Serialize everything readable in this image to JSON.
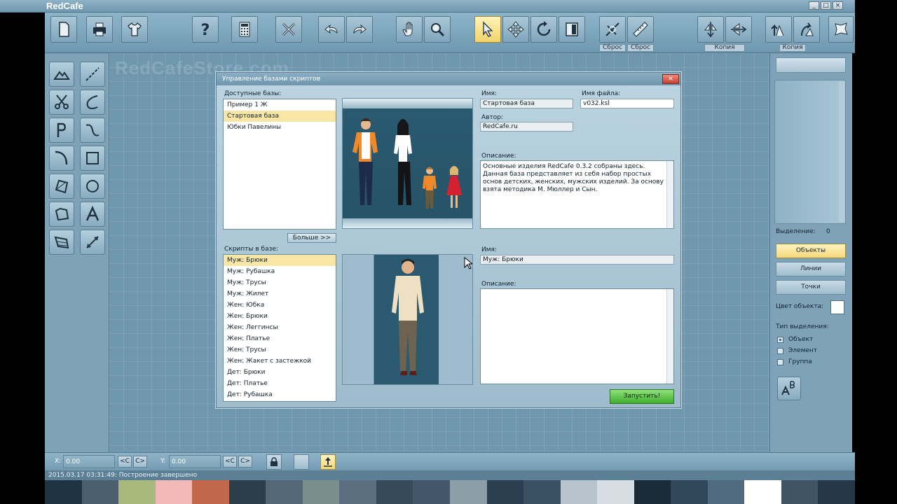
{
  "app": {
    "title": "RedCafe",
    "watermark": "RedCafeStore.com"
  },
  "window_controls": {
    "minimize": "_",
    "maximize": "□",
    "close": "×"
  },
  "toolbar": {
    "captions": {
      "reset_1": "Сброс",
      "reset_2": "Сброс",
      "copy_1": "Копия",
      "copy_2": "Копия"
    },
    "buttons": [
      "file-icon",
      "print-icon",
      "shirt-icon",
      "help-icon",
      "calculator-icon",
      "delete-icon",
      "undo-icon",
      "redo-icon",
      "hand-icon",
      "zoom-icon",
      "pointer-icon",
      "move-icon",
      "rotate-icon",
      "frame-icon",
      "reset-transform-icon",
      "ruler-icon",
      "mirror-vertical-icon",
      "mirror-horizontal-icon",
      "copy-left-icon",
      "copy-right-icon",
      "shape-icon"
    ]
  },
  "leftbar": {
    "tools": [
      "mountain-icon",
      "line-icon",
      "scissors-icon",
      "arc-icon",
      "p-letter-icon",
      "curve-icon",
      "bend-icon",
      "rectangle-icon",
      "polygon-icon",
      "circle-icon",
      "shape-icon",
      "letter-a-icon",
      "fold-icon",
      "measure-icon"
    ]
  },
  "dialog": {
    "title": "Управление базами скриптов",
    "close": "×",
    "available_bases_label": "Доступные базы:",
    "bases": [
      {
        "label": "Пример 1 Ж",
        "selected": false
      },
      {
        "label": "Стартовая база",
        "selected": true
      },
      {
        "label": "Юбки Павелины",
        "selected": false
      }
    ],
    "more_button": "Больше >>",
    "scripts_label": "Скрипты в базе:",
    "scripts": [
      {
        "label": "Муж: Брюки",
        "selected": true
      },
      {
        "label": "Муж: Рубашка",
        "selected": false
      },
      {
        "label": "Муж: Трусы",
        "selected": false
      },
      {
        "label": "Муж: Жилет",
        "selected": false
      },
      {
        "label": "Жен: Юбка",
        "selected": false
      },
      {
        "label": "Жен: Брюки",
        "selected": false
      },
      {
        "label": "Жен: Леггинсы",
        "selected": false
      },
      {
        "label": "Жен: Платье",
        "selected": false
      },
      {
        "label": "Жен: Трусы",
        "selected": false
      },
      {
        "label": "Жен: Жакет с застежкой",
        "selected": false
      },
      {
        "label": "Дет: Брюки",
        "selected": false
      },
      {
        "label": "Дет: Платье",
        "selected": false
      },
      {
        "label": "Дет: Рубашка",
        "selected": false
      }
    ],
    "base_info": {
      "name_label": "Имя:",
      "name_value": "Стартовая база",
      "file_label": "Имя файла:",
      "file_value": "v032.ksl",
      "author_label": "Автор:",
      "author_value": "RedCafe.ru",
      "desc_label": "Описание:",
      "desc_value": "Основные изделия RedCafe 0.3.2 собраны здесь. Данная база представляет из себя набор простых основ детских, женских, мужских изделий. За основу взята методика М. Мюллер и Сын."
    },
    "script_info": {
      "name_label": "Имя:",
      "name_value": "Муж: Брюки",
      "desc_label": "Описание:",
      "desc_value": ""
    },
    "run_button": "Запустить!"
  },
  "rightpanel": {
    "selection_label": "Выделение:",
    "selection_count": "0",
    "buttons": [
      {
        "label": "Объекты",
        "active": true
      },
      {
        "label": "Линии",
        "active": false
      },
      {
        "label": "Точки",
        "active": false
      }
    ],
    "object_color_label": "Цвет объекта:",
    "object_color": "#ffffff",
    "selection_type_label": "Тип выделения:",
    "selection_types": [
      {
        "label": "Объект",
        "checked": true
      },
      {
        "label": "Элемент",
        "checked": false
      },
      {
        "label": "Группа",
        "checked": false
      }
    ]
  },
  "coordbar": {
    "x_label": "X:",
    "x_value": "0.00",
    "y_label": "Y:",
    "y_value": "0.00",
    "prev": "<C",
    "next": "C>"
  },
  "status": {
    "text": "2015.03.17 03:31:49: Построение завершено"
  },
  "palette": [
    "#1f3344",
    "#4a5e6e",
    "#a7b97c",
    "#f2b7b7",
    "#c2684a",
    "#2c3d4c",
    "#526878",
    "#7b8e8a",
    "#5c6f80",
    "#374a5a",
    "#42586a",
    "#8d9ea8",
    "#2b3f50",
    "#3a5063",
    "#b6c3cb",
    "#d7dee3",
    "#1a2a38",
    "#31485b",
    "#506a7f",
    "#ffffff",
    "#3f5566",
    "#263848"
  ]
}
